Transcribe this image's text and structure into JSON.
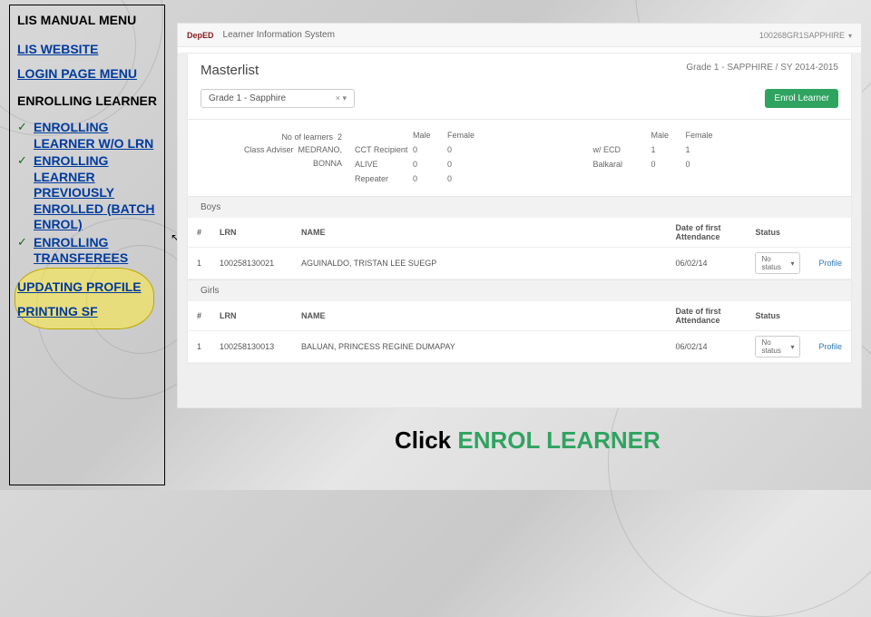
{
  "sidebar": {
    "title": "LIS MANUAL MENU",
    "links": {
      "website": "LIS WEBSITE",
      "login": "LOGIN PAGE MENU",
      "updating": "UPDATING PROFILE",
      "printing": "PRINTING SF"
    },
    "current": "ENROLLING LEARNER",
    "items": [
      "ENROLLING LEARNER W/O LRN",
      "ENROLLING LEARNER PREVIOUSLY ENROLLED (BATCH ENROL)",
      "ENROLLING TRANSFEREES"
    ]
  },
  "app": {
    "logo": "DepED",
    "name": "Learner Information System",
    "user": "100268GR1SAPPHIRE"
  },
  "masterlist": {
    "title": "Masterlist",
    "context": "Grade 1 - SAPPHIRE / SY 2014-2015",
    "combo": "Grade 1 - Sapphire",
    "enrol_btn": "Enrol Learner"
  },
  "stats": {
    "left": {
      "num_label": "No of learners",
      "num_value": "2",
      "adv_label": "Class Adviser",
      "adv_value": "MEDRANO, BONNA"
    },
    "mid": {
      "head": [
        "",
        "Male",
        "Female"
      ],
      "rows": [
        [
          "CCT Recipient",
          "0",
          "0"
        ],
        [
          "ALIVE",
          "0",
          "0"
        ],
        [
          "Repeater",
          "0",
          "0"
        ]
      ]
    },
    "right": {
      "head": [
        "",
        "Male",
        "Female"
      ],
      "rows": [
        [
          "w/ ECD",
          "1",
          "1"
        ],
        [
          "Balkaral",
          "0",
          "0"
        ]
      ]
    }
  },
  "boys": {
    "label": "Boys",
    "header": [
      "#",
      "LRN",
      "NAME",
      "Date of first Attendance",
      "Status",
      ""
    ],
    "row": [
      "1",
      "100258130021",
      "AGUINALDO, TRISTAN LEE SUEGP",
      "06/02/14",
      "No status",
      "Profile"
    ]
  },
  "girls": {
    "label": "Girls",
    "header": [
      "#",
      "LRN",
      "NAME",
      "Date of first Attendance",
      "Status",
      ""
    ],
    "row": [
      "1",
      "100258130013",
      "BALUAN, PRINCESS REGINE DUMAPAY",
      "06/02/14",
      "No status",
      "Profile"
    ]
  },
  "caption": {
    "prefix": "Click ",
    "action": "ENROL LEARNER"
  }
}
